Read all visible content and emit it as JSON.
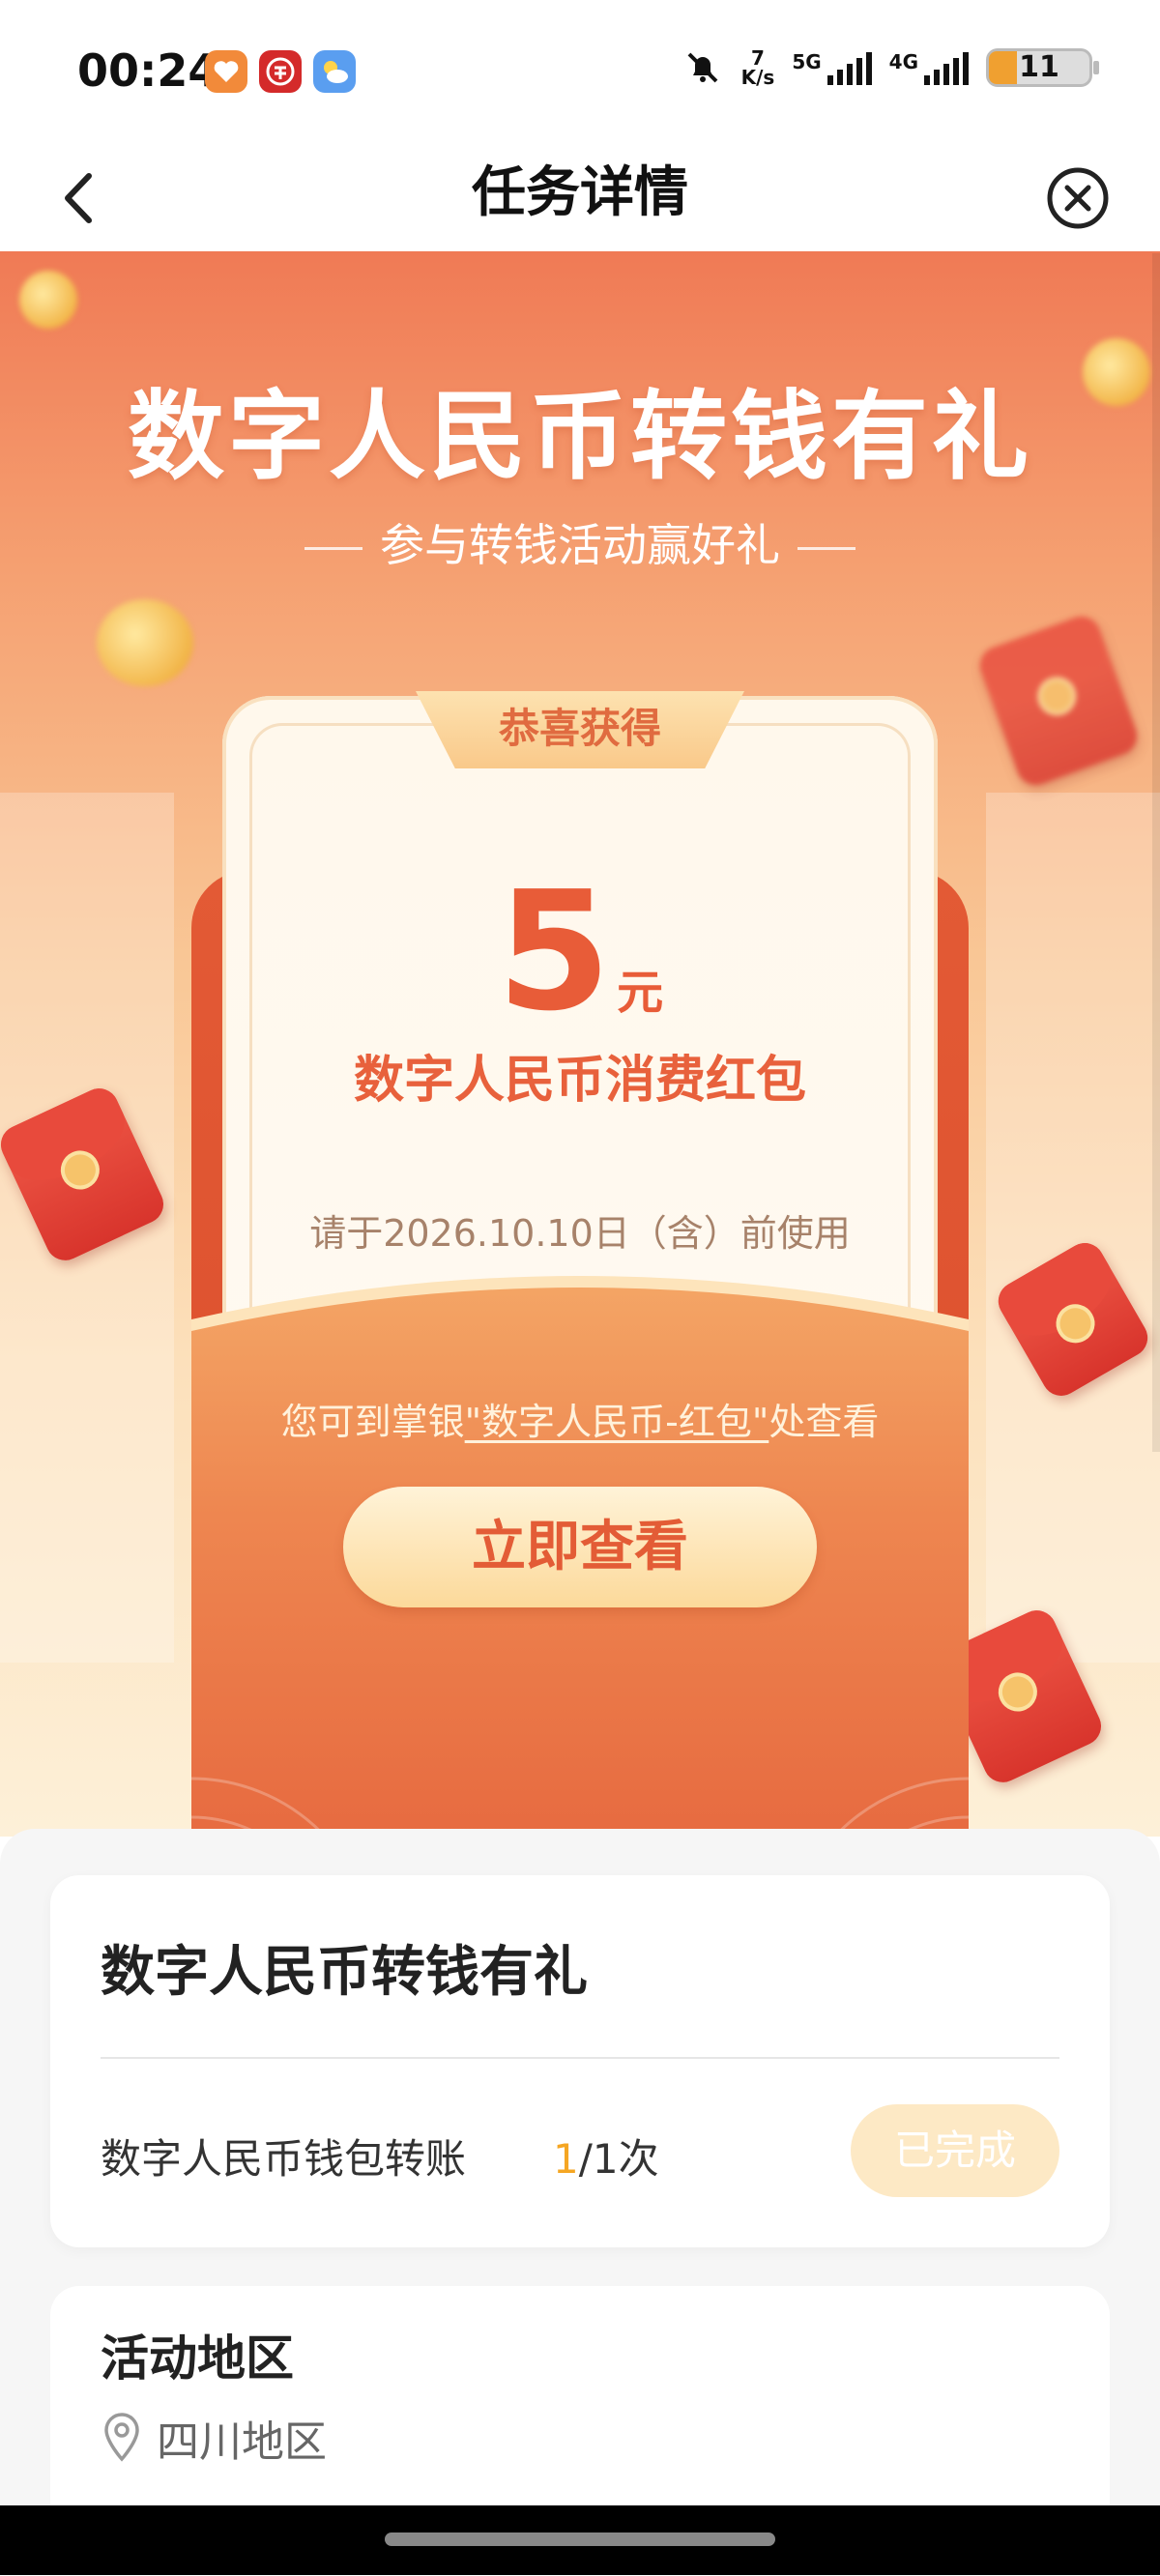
{
  "status_bar": {
    "time": "00:24",
    "net_speed_value": "7",
    "net_speed_unit": "K/s",
    "signal1_label": "5G",
    "signal2_label": "4G",
    "battery": "11",
    "colors": {
      "battery_fill": "#f0a030"
    }
  },
  "nav": {
    "title": "任务详情",
    "back_icon": "chevron-left-icon",
    "close_icon": "close-circle-icon"
  },
  "hero": {
    "title": "数字人民币转钱有礼",
    "subtitle": "参与转钱活动赢好礼",
    "card": {
      "tab_label": "恭喜获得",
      "amount": "5",
      "unit": "元",
      "reward_name": "数字人民币消费红包",
      "expiry": "请于2026.10.10日（含）前使用",
      "hint_prefix": "您可到掌银",
      "hint_link": "\"数字人民币-红包\"",
      "hint_suffix": "处查看",
      "button_label": "立即查看"
    },
    "colors": {
      "accent": "#e85c38",
      "button_text": "#e35c36"
    }
  },
  "task": {
    "title": "数字人民币转钱有礼",
    "item_name": "数字人民币钱包转账",
    "progress_done": "1",
    "progress_total": "/1次",
    "status_button": "已完成",
    "colors": {
      "progress": "#f5a623",
      "done_button": "#fde9c5"
    }
  },
  "region": {
    "title": "活动地区",
    "icon": "location-pin-icon",
    "value": "四川地区"
  }
}
